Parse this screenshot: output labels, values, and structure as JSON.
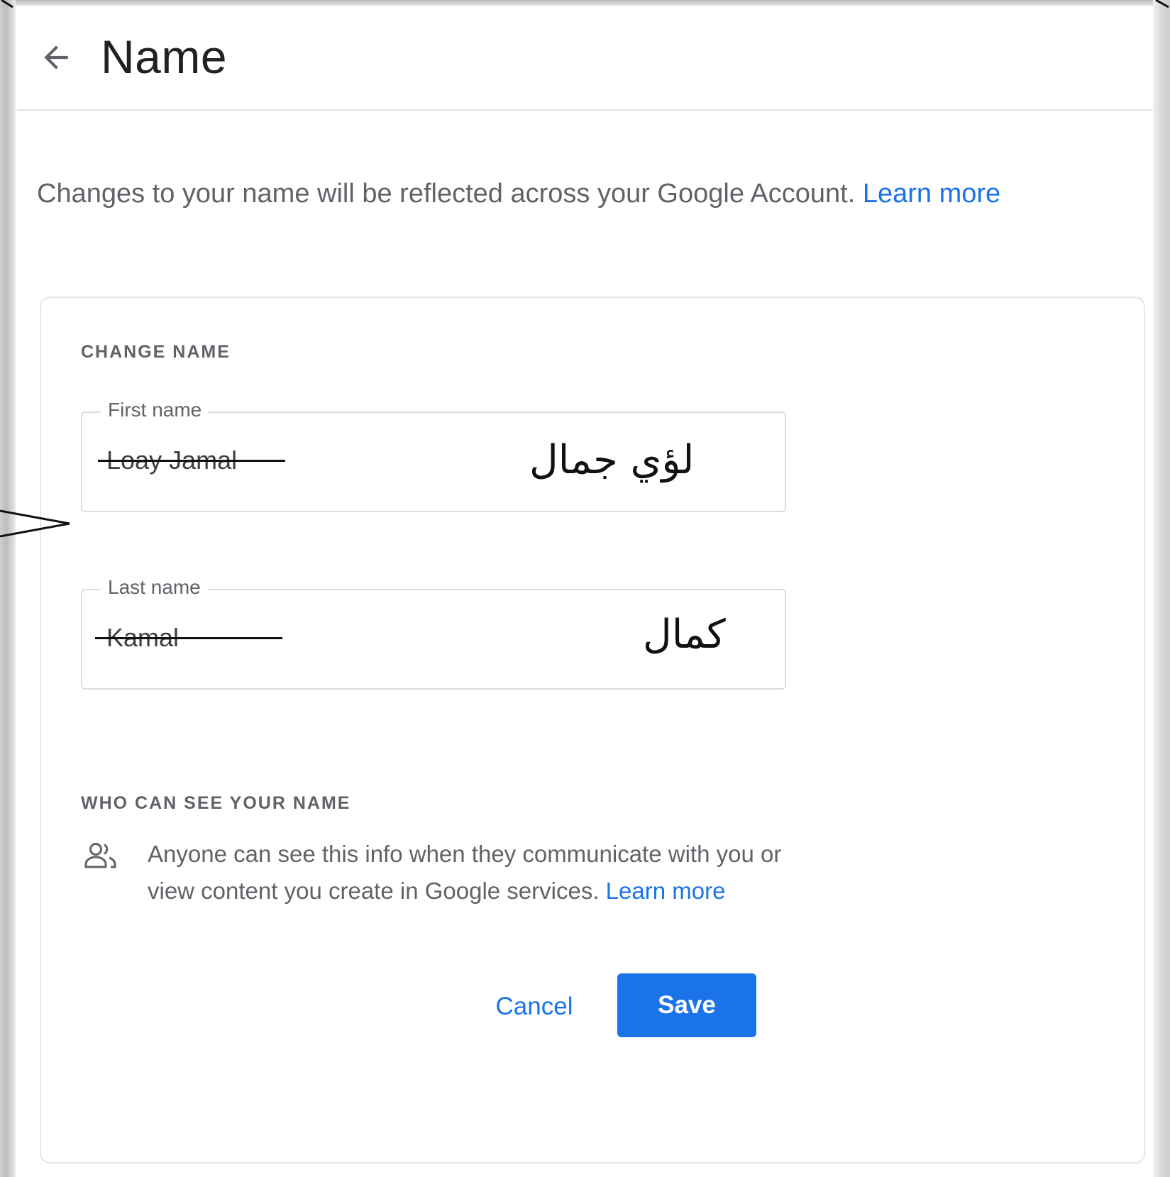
{
  "header": {
    "back_icon": "arrow-back-icon",
    "title": "Name"
  },
  "intro": {
    "text": "Changes to your name will be reflected across your Google Account.",
    "link": "Learn more"
  },
  "change_name": {
    "section_label": "CHANGE NAME",
    "first_name": {
      "label": "First name",
      "value": "Loay Jamal",
      "handwritten_annotation": "لؤي جمال"
    },
    "last_name": {
      "label": "Last name",
      "value": "Kamal",
      "handwritten_annotation": "كمال"
    }
  },
  "visibility": {
    "section_label": "WHO CAN SEE YOUR NAME",
    "icon": "people-icon",
    "text": "Anyone can see this info when they communicate with you or view content you create in Google services.",
    "link": "Learn more"
  },
  "actions": {
    "cancel_label": "Cancel",
    "save_label": "Save"
  },
  "colors": {
    "accent": "#1a73e8",
    "text_primary": "#202124",
    "text_secondary": "#5f6368",
    "border": "#dadce0"
  }
}
